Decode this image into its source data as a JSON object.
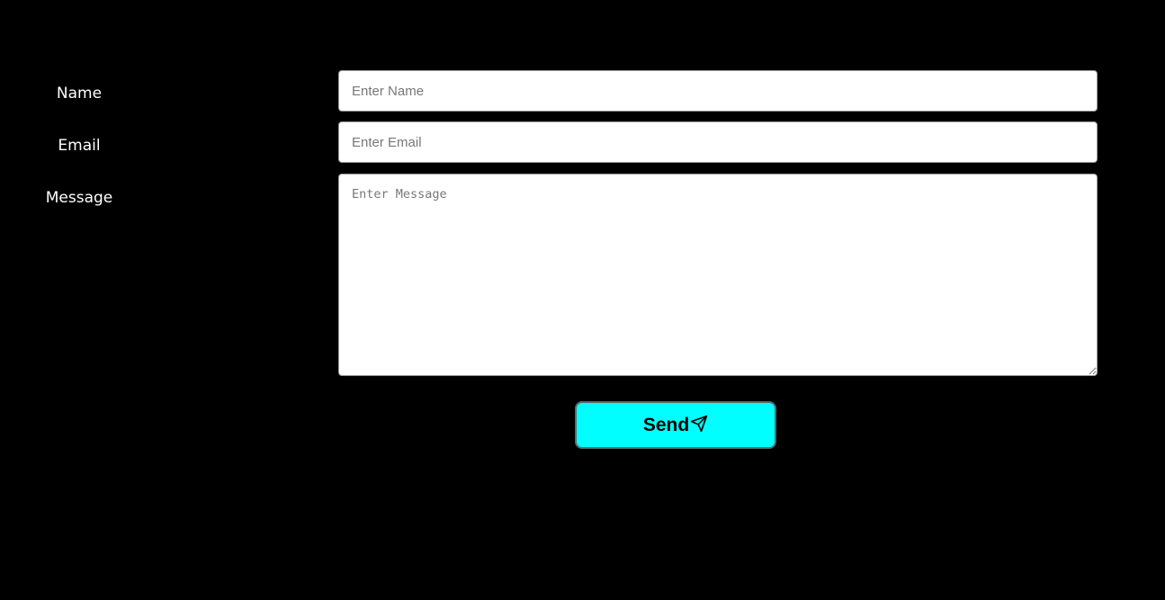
{
  "form": {
    "name_label": "Name",
    "email_label": "Email",
    "message_label": "Message",
    "name_placeholder": "Enter Name",
    "email_placeholder": "Enter Email",
    "message_placeholder": "Enter Message",
    "send_label": "Send",
    "send_icon": "paper-plane-icon"
  },
  "colors": {
    "background": "#000000",
    "label_text": "#ffffff",
    "button_background": "#00ffff",
    "button_text": "#000000"
  }
}
